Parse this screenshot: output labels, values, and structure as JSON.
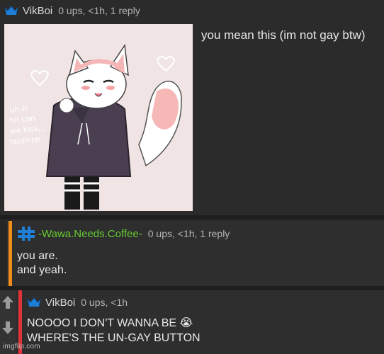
{
  "comments": [
    {
      "username": "VikBoi",
      "meta": "0 ups, <1h, 1 reply",
      "text": "you mean this (im not gay btw)",
      "image": {
        "description_icon": "furry-character-image",
        "drawn_text": "uh-h hii can we kiss,,, fasdfkpp"
      }
    },
    {
      "username": "-Wawa.Needs.Coffee-",
      "meta": "0 ups, <1h, 1 reply",
      "lines": [
        "you are.",
        "and yeah."
      ],
      "stripe_color": "#f28c18"
    },
    {
      "username": "VikBoi",
      "meta": "0 ups, <1h",
      "lines": [
        "NOOOO I DON'T WANNA BE 😭",
        "WHERE'S THE UN-GAY BUTTON"
      ],
      "stripe_color": "#e0343a"
    }
  ],
  "watermark": "imgflip.com",
  "colors": {
    "crown": "#1f7fd6",
    "username_green": "#66cc33",
    "bg": "#2a2a2a"
  }
}
